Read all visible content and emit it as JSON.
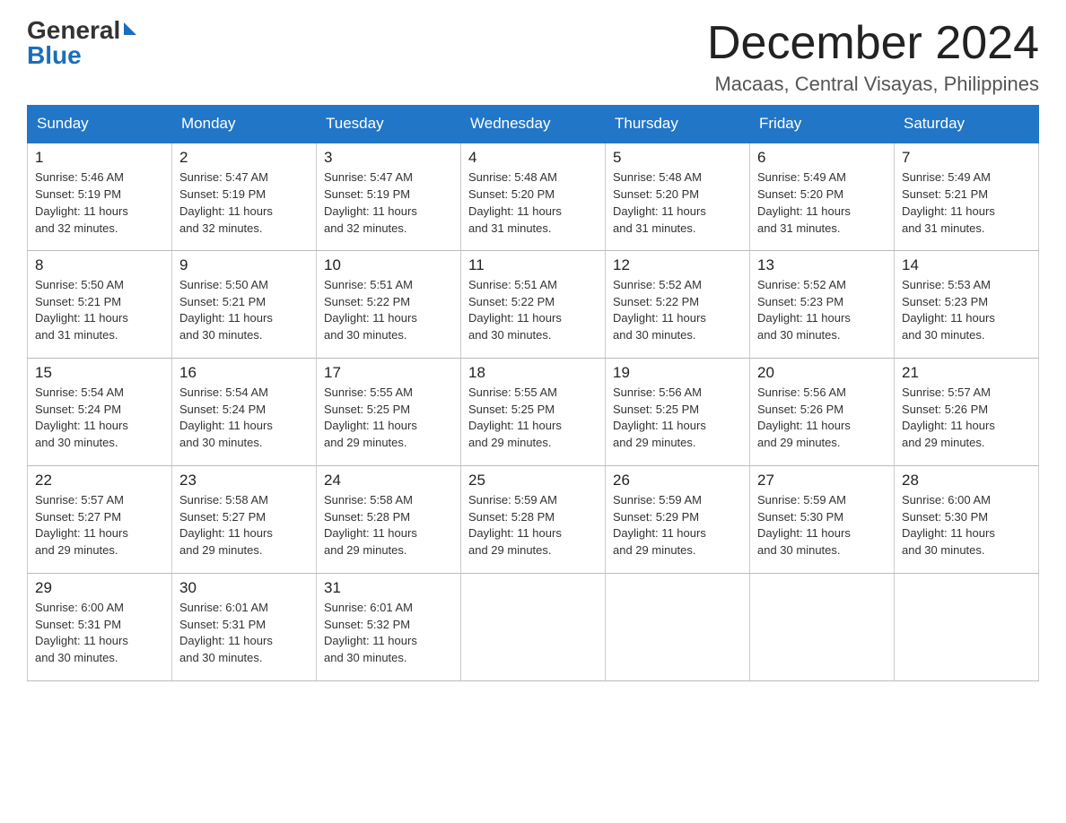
{
  "logo": {
    "general": "General",
    "blue": "Blue"
  },
  "header": {
    "month_title": "December 2024",
    "location": "Macaas, Central Visayas, Philippines"
  },
  "days_of_week": [
    "Sunday",
    "Monday",
    "Tuesday",
    "Wednesday",
    "Thursday",
    "Friday",
    "Saturday"
  ],
  "weeks": [
    [
      {
        "day": "1",
        "sunrise": "5:46 AM",
        "sunset": "5:19 PM",
        "daylight": "11 hours and 32 minutes."
      },
      {
        "day": "2",
        "sunrise": "5:47 AM",
        "sunset": "5:19 PM",
        "daylight": "11 hours and 32 minutes."
      },
      {
        "day": "3",
        "sunrise": "5:47 AM",
        "sunset": "5:19 PM",
        "daylight": "11 hours and 32 minutes."
      },
      {
        "day": "4",
        "sunrise": "5:48 AM",
        "sunset": "5:20 PM",
        "daylight": "11 hours and 31 minutes."
      },
      {
        "day": "5",
        "sunrise": "5:48 AM",
        "sunset": "5:20 PM",
        "daylight": "11 hours and 31 minutes."
      },
      {
        "day": "6",
        "sunrise": "5:49 AM",
        "sunset": "5:20 PM",
        "daylight": "11 hours and 31 minutes."
      },
      {
        "day": "7",
        "sunrise": "5:49 AM",
        "sunset": "5:21 PM",
        "daylight": "11 hours and 31 minutes."
      }
    ],
    [
      {
        "day": "8",
        "sunrise": "5:50 AM",
        "sunset": "5:21 PM",
        "daylight": "11 hours and 31 minutes."
      },
      {
        "day": "9",
        "sunrise": "5:50 AM",
        "sunset": "5:21 PM",
        "daylight": "11 hours and 30 minutes."
      },
      {
        "day": "10",
        "sunrise": "5:51 AM",
        "sunset": "5:22 PM",
        "daylight": "11 hours and 30 minutes."
      },
      {
        "day": "11",
        "sunrise": "5:51 AM",
        "sunset": "5:22 PM",
        "daylight": "11 hours and 30 minutes."
      },
      {
        "day": "12",
        "sunrise": "5:52 AM",
        "sunset": "5:22 PM",
        "daylight": "11 hours and 30 minutes."
      },
      {
        "day": "13",
        "sunrise": "5:52 AM",
        "sunset": "5:23 PM",
        "daylight": "11 hours and 30 minutes."
      },
      {
        "day": "14",
        "sunrise": "5:53 AM",
        "sunset": "5:23 PM",
        "daylight": "11 hours and 30 minutes."
      }
    ],
    [
      {
        "day": "15",
        "sunrise": "5:54 AM",
        "sunset": "5:24 PM",
        "daylight": "11 hours and 30 minutes."
      },
      {
        "day": "16",
        "sunrise": "5:54 AM",
        "sunset": "5:24 PM",
        "daylight": "11 hours and 30 minutes."
      },
      {
        "day": "17",
        "sunrise": "5:55 AM",
        "sunset": "5:25 PM",
        "daylight": "11 hours and 29 minutes."
      },
      {
        "day": "18",
        "sunrise": "5:55 AM",
        "sunset": "5:25 PM",
        "daylight": "11 hours and 29 minutes."
      },
      {
        "day": "19",
        "sunrise": "5:56 AM",
        "sunset": "5:25 PM",
        "daylight": "11 hours and 29 minutes."
      },
      {
        "day": "20",
        "sunrise": "5:56 AM",
        "sunset": "5:26 PM",
        "daylight": "11 hours and 29 minutes."
      },
      {
        "day": "21",
        "sunrise": "5:57 AM",
        "sunset": "5:26 PM",
        "daylight": "11 hours and 29 minutes."
      }
    ],
    [
      {
        "day": "22",
        "sunrise": "5:57 AM",
        "sunset": "5:27 PM",
        "daylight": "11 hours and 29 minutes."
      },
      {
        "day": "23",
        "sunrise": "5:58 AM",
        "sunset": "5:27 PM",
        "daylight": "11 hours and 29 minutes."
      },
      {
        "day": "24",
        "sunrise": "5:58 AM",
        "sunset": "5:28 PM",
        "daylight": "11 hours and 29 minutes."
      },
      {
        "day": "25",
        "sunrise": "5:59 AM",
        "sunset": "5:28 PM",
        "daylight": "11 hours and 29 minutes."
      },
      {
        "day": "26",
        "sunrise": "5:59 AM",
        "sunset": "5:29 PM",
        "daylight": "11 hours and 29 minutes."
      },
      {
        "day": "27",
        "sunrise": "5:59 AM",
        "sunset": "5:30 PM",
        "daylight": "11 hours and 30 minutes."
      },
      {
        "day": "28",
        "sunrise": "6:00 AM",
        "sunset": "5:30 PM",
        "daylight": "11 hours and 30 minutes."
      }
    ],
    [
      {
        "day": "29",
        "sunrise": "6:00 AM",
        "sunset": "5:31 PM",
        "daylight": "11 hours and 30 minutes."
      },
      {
        "day": "30",
        "sunrise": "6:01 AM",
        "sunset": "5:31 PM",
        "daylight": "11 hours and 30 minutes."
      },
      {
        "day": "31",
        "sunrise": "6:01 AM",
        "sunset": "5:32 PM",
        "daylight": "11 hours and 30 minutes."
      },
      null,
      null,
      null,
      null
    ]
  ],
  "labels": {
    "sunrise": "Sunrise:",
    "sunset": "Sunset:",
    "daylight": "Daylight:"
  }
}
